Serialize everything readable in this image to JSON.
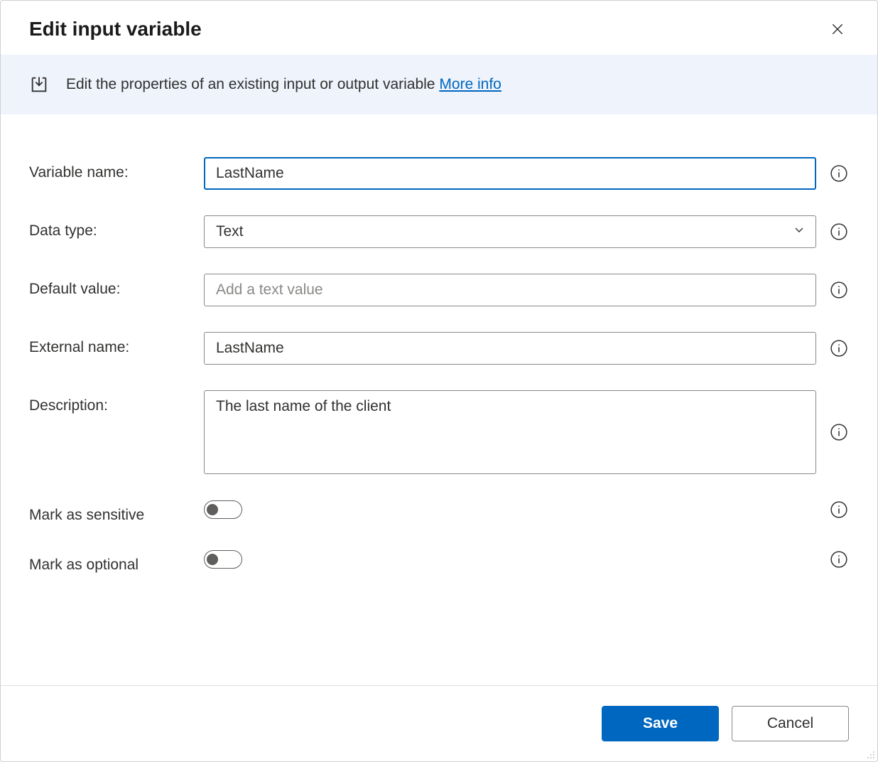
{
  "dialog": {
    "title": "Edit input variable",
    "banner_text": "Edit the properties of an existing input or output variable ",
    "banner_link": "More info"
  },
  "form": {
    "variable_name": {
      "label": "Variable name:",
      "value": "LastName"
    },
    "data_type": {
      "label": "Data type:",
      "value": "Text"
    },
    "default_value": {
      "label": "Default value:",
      "value": "",
      "placeholder": "Add a text value"
    },
    "external_name": {
      "label": "External name:",
      "value": "LastName"
    },
    "description": {
      "label": "Description:",
      "value": "The last name of the client"
    },
    "mark_sensitive": {
      "label": "Mark as sensitive",
      "value": false
    },
    "mark_optional": {
      "label": "Mark as optional",
      "value": false
    }
  },
  "footer": {
    "save": "Save",
    "cancel": "Cancel"
  }
}
